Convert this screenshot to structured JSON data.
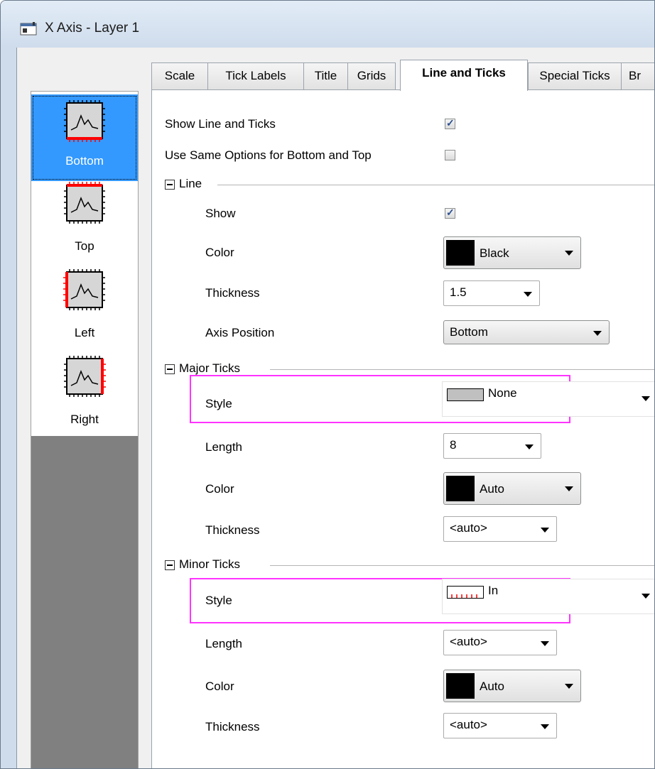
{
  "window": {
    "title": "X Axis - Layer 1"
  },
  "axis_list": [
    {
      "label": "Bottom",
      "selected": true
    },
    {
      "label": "Top",
      "selected": false
    },
    {
      "label": "Left",
      "selected": false
    },
    {
      "label": "Right",
      "selected": false
    }
  ],
  "tabs": [
    {
      "label": "Scale"
    },
    {
      "label": "Tick Labels"
    },
    {
      "label": "Title"
    },
    {
      "label": "Grids"
    },
    {
      "label": "Line and Ticks",
      "active": true
    },
    {
      "label": "Special Ticks"
    },
    {
      "label": "Br"
    }
  ],
  "options": {
    "show_line_and_ticks": {
      "label": "Show Line and Ticks",
      "checked": true
    },
    "same_options": {
      "label": "Use Same Options for Bottom and Top",
      "checked": false
    }
  },
  "line": {
    "group_title": "Line",
    "show_label": "Show",
    "show_checked": true,
    "color_label": "Color",
    "color_value": "Black",
    "color_hex": "#000000",
    "thickness_label": "Thickness",
    "thickness_value": "1.5",
    "axis_position_label": "Axis Position",
    "axis_position_value": "Bottom"
  },
  "major_ticks": {
    "group_title": "Major Ticks",
    "style_label": "Style",
    "style_value": "None",
    "length_label": "Length",
    "length_value": "8",
    "color_label": "Color",
    "color_value": "Auto",
    "color_hex": "#000000",
    "thickness_label": "Thickness",
    "thickness_value": "<auto>"
  },
  "minor_ticks": {
    "group_title": "Minor Ticks",
    "style_label": "Style",
    "style_value": "In",
    "length_label": "Length",
    "length_value": "<auto>",
    "color_label": "Color",
    "color_value": "Auto",
    "color_hex": "#000000",
    "thickness_label": "Thickness",
    "thickness_value": "<auto>"
  },
  "colors": {
    "selection": "#3399ff",
    "highlight": "#ff33ff",
    "tick_red": "#ff0000"
  }
}
